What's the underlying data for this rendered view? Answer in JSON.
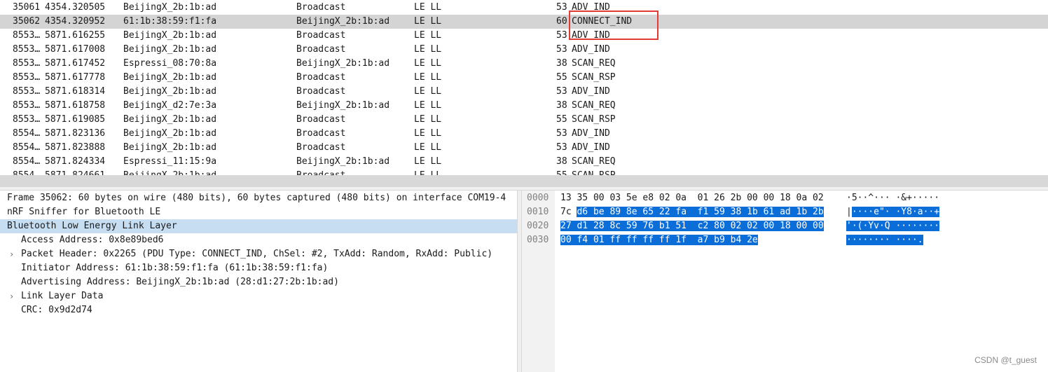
{
  "packet_list": {
    "rows": [
      {
        "no": "35061",
        "time": "4354.320505",
        "source": "BeijingX_2b:1b:ad",
        "destination": "Broadcast",
        "protocol": "LE LL",
        "length": "53",
        "info": "ADV_IND",
        "selected": false
      },
      {
        "no": "35062",
        "time": "4354.320952",
        "source": "61:1b:38:59:f1:fa",
        "destination": "BeijingX_2b:1b:ad",
        "protocol": "LE LL",
        "length": "60",
        "info": "CONNECT_IND",
        "selected": true
      },
      {
        "no": "8553…",
        "time": "5871.616255",
        "source": "BeijingX_2b:1b:ad",
        "destination": "Broadcast",
        "protocol": "LE LL",
        "length": "53",
        "info": "ADV_IND",
        "selected": false
      },
      {
        "no": "8553…",
        "time": "5871.617008",
        "source": "BeijingX_2b:1b:ad",
        "destination": "Broadcast",
        "protocol": "LE LL",
        "length": "53",
        "info": "ADV_IND",
        "selected": false
      },
      {
        "no": "8553…",
        "time": "5871.617452",
        "source": "Espressi_08:70:8a",
        "destination": "BeijingX_2b:1b:ad",
        "protocol": "LE LL",
        "length": "38",
        "info": "SCAN_REQ",
        "selected": false
      },
      {
        "no": "8553…",
        "time": "5871.617778",
        "source": "BeijingX_2b:1b:ad",
        "destination": "Broadcast",
        "protocol": "LE LL",
        "length": "55",
        "info": "SCAN_RSP",
        "selected": false
      },
      {
        "no": "8553…",
        "time": "5871.618314",
        "source": "BeijingX_2b:1b:ad",
        "destination": "Broadcast",
        "protocol": "LE LL",
        "length": "53",
        "info": "ADV_IND",
        "selected": false
      },
      {
        "no": "8553…",
        "time": "5871.618758",
        "source": "BeijingX_d2:7e:3a",
        "destination": "BeijingX_2b:1b:ad",
        "protocol": "LE LL",
        "length": "38",
        "info": "SCAN_REQ",
        "selected": false
      },
      {
        "no": "8553…",
        "time": "5871.619085",
        "source": "BeijingX_2b:1b:ad",
        "destination": "Broadcast",
        "protocol": "LE LL",
        "length": "55",
        "info": "SCAN_RSP",
        "selected": false
      },
      {
        "no": "8554…",
        "time": "5871.823136",
        "source": "BeijingX_2b:1b:ad",
        "destination": "Broadcast",
        "protocol": "LE LL",
        "length": "53",
        "info": "ADV_IND",
        "selected": false
      },
      {
        "no": "8554…",
        "time": "5871.823888",
        "source": "BeijingX_2b:1b:ad",
        "destination": "Broadcast",
        "protocol": "LE LL",
        "length": "53",
        "info": "ADV_IND",
        "selected": false
      },
      {
        "no": "8554…",
        "time": "5871.824334",
        "source": "Espressi_11:15:9a",
        "destination": "BeijingX_2b:1b:ad",
        "protocol": "LE LL",
        "length": "38",
        "info": "SCAN_REQ",
        "selected": false
      },
      {
        "no": "8554…",
        "time": "5871.824661",
        "source": "BeijingX_2b:1b:ad",
        "destination": "Broadcast",
        "protocol": "LE LL",
        "length": "55",
        "info": "SCAN_RSP",
        "selected": false
      }
    ]
  },
  "details": {
    "rows": [
      {
        "text": "Frame 35062: 60 bytes on wire (480 bits), 60 bytes captured (480 bits) on interface COM19-4",
        "indent": 0,
        "expander": "",
        "selected": false
      },
      {
        "text": "nRF Sniffer for Bluetooth LE",
        "indent": 0,
        "expander": "",
        "selected": false
      },
      {
        "text": "Bluetooth Low Energy Link Layer",
        "indent": 0,
        "expander": "",
        "selected": true
      },
      {
        "text": "Access Address: 0x8e89bed6",
        "indent": 1,
        "expander": "",
        "selected": false
      },
      {
        "text": "Packet Header: 0x2265 (PDU Type: CONNECT_IND, ChSel: #2, TxAdd: Random, RxAdd: Public)",
        "indent": 1,
        "expander": "›",
        "selected": false
      },
      {
        "text": "Initiator Address: 61:1b:38:59:f1:fa (61:1b:38:59:f1:fa)",
        "indent": 1,
        "expander": "",
        "selected": false
      },
      {
        "text": "Advertising Address: BeijingX_2b:1b:ad (28:d1:27:2b:1b:ad)",
        "indent": 1,
        "expander": "",
        "selected": false
      },
      {
        "text": "Link Layer Data",
        "indent": 1,
        "expander": "›",
        "selected": false
      },
      {
        "text": "CRC: 0x9d2d74",
        "indent": 1,
        "expander": "",
        "selected": false
      }
    ]
  },
  "bytes": {
    "lines": [
      {
        "offset": "0000",
        "hex_plain": "13 35 00 03 5e e8 02 0a  01 26 2b 00 00 18 0a 02",
        "hex_sel": "",
        "ascii_plain": "·5··^··· ·&+·····",
        "ascii_sel": ""
      },
      {
        "offset": "0010",
        "hex_plain": "7c ",
        "hex_sel": "d6 be 89 8e 65 22 fa  f1 59 38 1b 61 ad 1b 2b",
        "ascii_plain": "|",
        "ascii_sel": "····e\"· ·Y8·a··+"
      },
      {
        "offset": "0020",
        "hex_plain": "",
        "hex_sel": "27 d1 28 8c 59 76 b1 51  c2 80 02 02 00 18 00 00",
        "ascii_plain": "",
        "ascii_sel": "'·(·Yv·Q ········"
      },
      {
        "offset": "0030",
        "hex_plain": "",
        "hex_sel": "00 f4 01 ff ff ff ff 1f  a7 b9 b4 2e",
        "ascii_plain": "",
        "ascii_sel": "········ ····."
      }
    ]
  },
  "watermark": "CSDN @t_guest",
  "colors": {
    "selected_row": "#d4d4d4",
    "tree_selected": "#c6ddf2",
    "byte_selection": "#0a6dd8",
    "highlight_box": "#e53935"
  }
}
